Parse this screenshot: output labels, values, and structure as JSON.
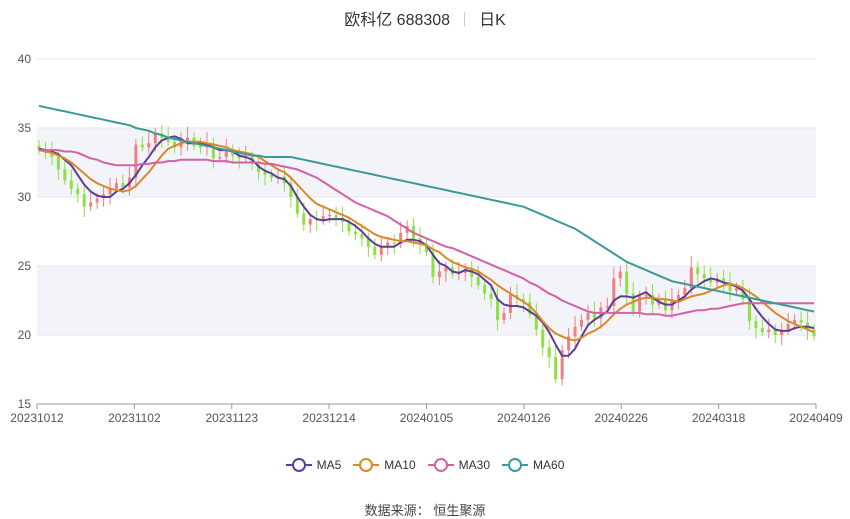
{
  "header": {
    "title": "欧科亿 688308",
    "period": "日K"
  },
  "source": {
    "label": "数据来源：",
    "name": "恒生聚源"
  },
  "chart_data": {
    "type": "candlestick",
    "ylim": [
      15,
      40
    ],
    "yticks": [
      15,
      20,
      25,
      30,
      35,
      40
    ],
    "x_tick_labels": [
      "20231012",
      "20231102",
      "20231123",
      "20231214",
      "20240105",
      "20240126",
      "20240226",
      "20240318",
      "20240409"
    ],
    "trading_days": 121,
    "up_color": "#f08080",
    "down_color": "#8fe040",
    "band_color": "#f2f4fa",
    "candle_close": [
      33.4,
      33.2,
      32.9,
      32.0,
      31.2,
      30.6,
      30.2,
      29.3,
      29.6,
      29.9,
      30.2,
      30.6,
      31.0,
      30.7,
      31.4,
      33.8,
      33.6,
      33.9,
      34.6,
      34.3,
      34.0,
      33.6,
      34.1,
      34.3,
      33.7,
      33.6,
      33.9,
      32.8,
      32.9,
      33.4,
      33.0,
      32.8,
      32.9,
      32.4,
      31.8,
      31.6,
      31.4,
      31.5,
      31.0,
      30.0,
      28.8,
      28.0,
      28.4,
      28.3,
      28.6,
      28.7,
      28.5,
      28.2,
      27.5,
      27.3,
      27.0,
      26.4,
      25.8,
      26.4,
      26.7,
      26.6,
      27.4,
      27.9,
      27.0,
      26.6,
      26.0,
      24.2,
      24.6,
      24.9,
      24.4,
      24.5,
      24.8,
      24.2,
      23.6,
      23.0,
      22.6,
      21.1,
      21.6,
      22.9,
      22.6,
      22.4,
      21.5,
      20.4,
      19.1,
      18.4,
      16.8,
      18.9,
      19.9,
      20.6,
      21.1,
      21.6,
      21.2,
      22.0,
      22.1,
      24.1,
      24.6,
      23.0,
      21.7,
      22.8,
      22.9,
      22.2,
      22.6,
      21.8,
      22.6,
      22.9,
      23.4,
      24.9,
      24.4,
      24.1,
      23.8,
      24.1,
      23.8,
      23.2,
      23.4,
      22.6,
      21.0,
      20.5,
      20.2,
      20.4,
      20.0,
      20.3,
      20.8,
      21.1,
      20.9,
      20.4,
      19.9
    ],
    "series": [
      {
        "name": "MA5",
        "color": "#5b3e96",
        "values": [
          33.5,
          33.4,
          33.3,
          33.1,
          32.7,
          32.3,
          31.6,
          30.9,
          30.4,
          30.1,
          30.0,
          30.0,
          30.4,
          30.6,
          31.0,
          31.6,
          32.3,
          32.9,
          33.6,
          34.1,
          34.3,
          34.4,
          34.2,
          33.9,
          33.9,
          33.9,
          33.8,
          33.6,
          33.4,
          33.4,
          33.3,
          33.0,
          32.9,
          32.7,
          32.2,
          31.9,
          31.7,
          31.4,
          31.3,
          30.8,
          30.0,
          29.3,
          28.7,
          28.4,
          28.3,
          28.4,
          28.4,
          28.4,
          28.2,
          27.9,
          27.5,
          27.0,
          26.6,
          26.4,
          26.4,
          26.4,
          26.7,
          26.9,
          26.9,
          26.8,
          26.5,
          25.8,
          25.2,
          25.0,
          24.6,
          24.5,
          24.7,
          24.6,
          24.4,
          24.0,
          23.6,
          22.6,
          22.2,
          22.1,
          22.1,
          22.0,
          21.7,
          21.4,
          20.9,
          20.2,
          19.3,
          18.5,
          18.5,
          19.0,
          19.9,
          20.7,
          21.1,
          21.4,
          21.7,
          22.5,
          22.8,
          22.8,
          22.7,
          22.9,
          23.1,
          22.7,
          22.4,
          22.2,
          22.2,
          22.5,
          22.8,
          23.3,
          23.6,
          23.9,
          24.1,
          24.0,
          23.8,
          23.7,
          23.5,
          23.2,
          22.6,
          21.9,
          21.3,
          20.8,
          20.4,
          20.3,
          20.3,
          20.5,
          20.6,
          20.6,
          20.5
        ]
      },
      {
        "name": "MA10",
        "color": "#d9882a",
        "values": [
          33.4,
          33.3,
          33.2,
          33.0,
          32.8,
          32.5,
          32.1,
          31.7,
          31.3,
          31.0,
          30.8,
          30.6,
          30.5,
          30.4,
          30.5,
          30.8,
          31.3,
          31.8,
          32.4,
          33.0,
          33.5,
          33.7,
          33.9,
          34.0,
          34.0,
          34.0,
          33.9,
          33.8,
          33.7,
          33.6,
          33.4,
          33.3,
          33.2,
          33.1,
          32.9,
          32.6,
          32.3,
          32.0,
          31.8,
          31.4,
          30.9,
          30.4,
          29.9,
          29.5,
          29.3,
          29.1,
          28.9,
          28.7,
          28.5,
          28.2,
          27.9,
          27.6,
          27.3,
          27.1,
          27.0,
          26.9,
          26.8,
          26.8,
          26.7,
          26.6,
          26.5,
          26.2,
          26.0,
          25.6,
          25.3,
          25.1,
          24.9,
          24.8,
          24.6,
          24.3,
          24.0,
          23.6,
          23.3,
          23.0,
          22.7,
          22.4,
          22.1,
          21.6,
          21.0,
          20.5,
          20.1,
          19.9,
          19.7,
          19.6,
          19.8,
          20.1,
          20.3,
          20.6,
          21.0,
          21.5,
          21.9,
          22.2,
          22.4,
          22.6,
          22.7,
          22.7,
          22.6,
          22.6,
          22.5,
          22.4,
          22.6,
          22.8,
          22.9,
          23.0,
          23.2,
          23.4,
          23.6,
          23.7,
          23.6,
          23.4,
          23.1,
          22.8,
          22.4,
          22.0,
          21.6,
          21.3,
          21.0,
          20.8,
          20.6,
          20.4,
          20.2
        ]
      },
      {
        "name": "MA30",
        "color": "#d460a8",
        "values": [
          33.4,
          33.4,
          33.4,
          33.4,
          33.3,
          33.3,
          33.2,
          33.0,
          32.8,
          32.7,
          32.5,
          32.4,
          32.3,
          32.3,
          32.3,
          32.3,
          32.4,
          32.4,
          32.5,
          32.5,
          32.6,
          32.6,
          32.7,
          32.7,
          32.7,
          32.7,
          32.7,
          32.6,
          32.6,
          32.6,
          32.5,
          32.5,
          32.5,
          32.5,
          32.5,
          32.4,
          32.4,
          32.3,
          32.2,
          32.1,
          32.0,
          31.8,
          31.6,
          31.4,
          31.1,
          30.8,
          30.5,
          30.2,
          29.9,
          29.6,
          29.4,
          29.2,
          29.0,
          28.8,
          28.6,
          28.3,
          28.0,
          27.7,
          27.4,
          27.2,
          27.0,
          26.8,
          26.6,
          26.4,
          26.3,
          26.1,
          25.9,
          25.7,
          25.5,
          25.3,
          25.1,
          24.9,
          24.7,
          24.5,
          24.3,
          24.1,
          23.8,
          23.6,
          23.3,
          23.0,
          22.8,
          22.5,
          22.3,
          22.1,
          21.9,
          21.7,
          21.6,
          21.6,
          21.6,
          21.6,
          21.6,
          21.6,
          21.6,
          21.6,
          21.5,
          21.5,
          21.5,
          21.4,
          21.4,
          21.5,
          21.6,
          21.7,
          21.8,
          21.8,
          21.9,
          21.9,
          22.0,
          22.1,
          22.2,
          22.3,
          22.3,
          22.3,
          22.3,
          22.3,
          22.3,
          22.3,
          22.3,
          22.3,
          22.3,
          22.3,
          22.3
        ]
      },
      {
        "name": "MA60",
        "color": "#3d9997",
        "values": [
          36.6,
          36.5,
          36.4,
          36.3,
          36.2,
          36.1,
          36.0,
          35.9,
          35.8,
          35.7,
          35.6,
          35.5,
          35.4,
          35.3,
          35.2,
          35.0,
          34.9,
          34.8,
          34.6,
          34.5,
          34.3,
          34.2,
          34.1,
          34.0,
          33.9,
          33.8,
          33.7,
          33.6,
          33.5,
          33.4,
          33.3,
          33.2,
          33.1,
          33.0,
          33.0,
          32.9,
          32.9,
          32.9,
          32.9,
          32.9,
          32.8,
          32.7,
          32.6,
          32.5,
          32.4,
          32.3,
          32.2,
          32.1,
          32.0,
          31.9,
          31.8,
          31.7,
          31.6,
          31.5,
          31.4,
          31.3,
          31.2,
          31.1,
          31.0,
          30.9,
          30.8,
          30.7,
          30.6,
          30.5,
          30.4,
          30.3,
          30.2,
          30.1,
          30.0,
          29.9,
          29.8,
          29.7,
          29.6,
          29.5,
          29.4,
          29.3,
          29.1,
          28.9,
          28.7,
          28.5,
          28.3,
          28.1,
          27.9,
          27.7,
          27.4,
          27.1,
          26.8,
          26.5,
          26.2,
          25.9,
          25.6,
          25.3,
          25.1,
          24.9,
          24.7,
          24.5,
          24.3,
          24.1,
          23.9,
          23.8,
          23.7,
          23.6,
          23.5,
          23.4,
          23.3,
          23.2,
          23.1,
          23.0,
          22.9,
          22.8,
          22.7,
          22.6,
          22.5,
          22.4,
          22.3,
          22.2,
          22.1,
          22.0,
          21.9,
          21.8,
          21.7
        ]
      }
    ]
  }
}
